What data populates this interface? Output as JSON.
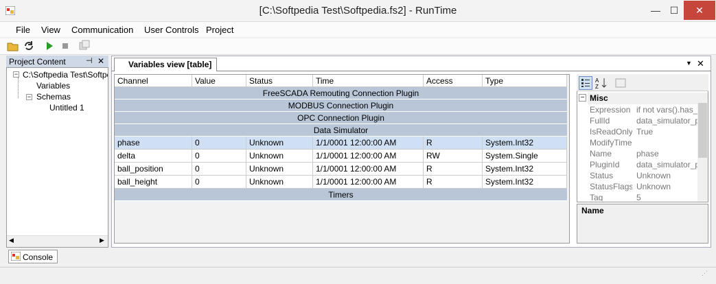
{
  "window": {
    "title": "[C:\\Softpedia Test\\Softpedia.fs2] - RunTime",
    "minimize": "—",
    "maximize": "☐",
    "close": "✕"
  },
  "menu": [
    "File",
    "View",
    "Communication",
    "User Controls",
    "Project"
  ],
  "project_panel": {
    "title": "Project Content",
    "pin": "⊣",
    "close": "✕",
    "tree": [
      "C:\\Softpedia Test\\Softped",
      "Variables",
      "Schemas",
      "Untitled 1"
    ],
    "scroll_left": "◀",
    "scroll_right": "▶"
  },
  "document": {
    "tab": "Variables view [table]",
    "dropdown": "▼",
    "close": "✕",
    "columns": [
      "Channel",
      "Value",
      "Status",
      "Time",
      "Access",
      "Type"
    ],
    "groups_top": [
      "FreeSCADA Remouting Connection Plugin",
      "MODBUS Connection Plugin",
      "OPC Connection Plugin",
      "Data Simulator"
    ],
    "rows": [
      [
        "phase",
        "0",
        "Unknown",
        "1/1/0001 12:00:00 AM",
        "R",
        "System.Int32"
      ],
      [
        "delta",
        "0",
        "Unknown",
        "1/1/0001 12:00:00 AM",
        "RW",
        "System.Single"
      ],
      [
        "ball_position",
        "0",
        "Unknown",
        "1/1/0001 12:00:00 AM",
        "R",
        "System.Int32"
      ],
      [
        "ball_height",
        "0",
        "Unknown",
        "1/1/0001 12:00:00 AM",
        "R",
        "System.Int32"
      ]
    ],
    "group_bottom": "Timers"
  },
  "properties": {
    "category": "Misc",
    "items": [
      [
        "Expression",
        "if not vars().has_ke"
      ],
      [
        "FullId",
        "data_simulator_plu"
      ],
      [
        "IsReadOnly",
        "True"
      ],
      [
        "ModifyTime",
        ""
      ],
      [
        "Name",
        "phase"
      ],
      [
        "PluginId",
        "data_simulator_plu"
      ],
      [
        "Status",
        "Unknown"
      ],
      [
        "StatusFlags",
        "Unknown"
      ],
      [
        "Tag",
        "5"
      ]
    ],
    "description_title": "Name"
  },
  "console": {
    "label": "Console"
  }
}
